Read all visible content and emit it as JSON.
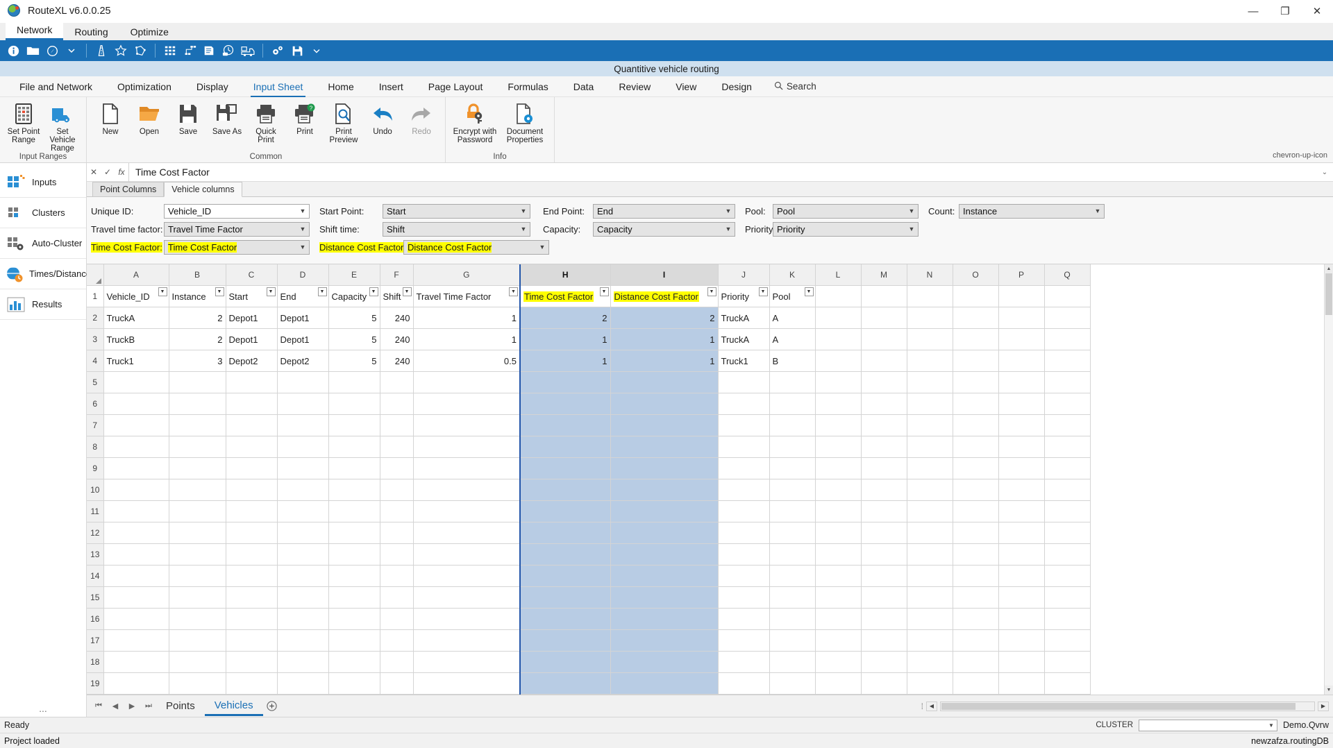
{
  "titlebar": {
    "app_title": "RouteXL v6.0.0.25",
    "minimize": "—",
    "maximize": "❐",
    "close": "✕"
  },
  "appmenu": {
    "items": [
      {
        "label": "Network",
        "active": true
      },
      {
        "label": "Routing",
        "active": false
      },
      {
        "label": "Optimize",
        "active": false
      }
    ]
  },
  "bluebar": {
    "icons": [
      "info-icon",
      "folder-icon",
      "compass-icon",
      "chevron-down-icon",
      "road-icon",
      "star-icon",
      "polygon-icon",
      "matrix-icon",
      "network-nodes-icon",
      "report-icon",
      "clock-icon",
      "truck-icon",
      "settings-gears-icon",
      "save-disk-icon",
      "chevron-down-small-icon"
    ]
  },
  "docbar": {
    "document_title": "Quantitive vehicle routing"
  },
  "ribbon_tabs": {
    "items": [
      {
        "label": "File and Network",
        "active": false
      },
      {
        "label": "Optimization",
        "active": false
      },
      {
        "label": "Display",
        "active": false
      },
      {
        "label": "Input Sheet",
        "active": true
      },
      {
        "label": "Home",
        "active": false
      },
      {
        "label": "Insert",
        "active": false
      },
      {
        "label": "Page Layout",
        "active": false
      },
      {
        "label": "Formulas",
        "active": false
      },
      {
        "label": "Data",
        "active": false
      },
      {
        "label": "Review",
        "active": false
      },
      {
        "label": "View",
        "active": false
      },
      {
        "label": "Design",
        "active": false
      }
    ],
    "search_label": "Search",
    "search_icon": "search-icon",
    "collapse_icon": "chevron-up-icon"
  },
  "ribbon": {
    "groups": [
      {
        "name": "Input Ranges",
        "buttons": [
          {
            "label": "Set Point Range",
            "icon": "grid-point-icon",
            "disabled": false
          },
          {
            "label": "Set Vehicle Range",
            "icon": "truck-icon",
            "disabled": false
          }
        ]
      },
      {
        "name": "Common",
        "buttons": [
          {
            "label": "New",
            "icon": "new-document-icon",
            "disabled": false
          },
          {
            "label": "Open",
            "icon": "open-folder-icon",
            "disabled": false
          },
          {
            "label": "Save",
            "icon": "save-disk-icon",
            "disabled": false
          },
          {
            "label": "Save As",
            "icon": "save-as-icon",
            "disabled": false
          },
          {
            "label": "Quick Print",
            "icon": "quick-print-icon",
            "disabled": false
          },
          {
            "label": "Print",
            "icon": "print-help-icon",
            "disabled": false
          },
          {
            "label": "Print Preview",
            "icon": "print-preview-icon",
            "disabled": false
          },
          {
            "label": "Undo",
            "icon": "undo-arrow-icon",
            "disabled": false
          },
          {
            "label": "Redo",
            "icon": "redo-arrow-icon",
            "disabled": true
          }
        ]
      },
      {
        "name": "Info",
        "buttons": [
          {
            "label": "Encrypt with Password",
            "icon": "lock-key-icon",
            "disabled": false
          },
          {
            "label": "Document Properties",
            "icon": "document-gear-icon",
            "disabled": false
          }
        ]
      }
    ]
  },
  "leftnav": {
    "items": [
      {
        "label": "Inputs",
        "icon": "grid-squares-icon"
      },
      {
        "label": "Clusters",
        "icon": "cluster-dots-icon"
      },
      {
        "label": "Auto-Cluster",
        "icon": "auto-cluster-icon"
      },
      {
        "label": "Times/Distances",
        "icon": "clock-globe-icon"
      },
      {
        "label": "Results",
        "icon": "bar-chart-icon"
      }
    ],
    "overflow": "..."
  },
  "formulabar": {
    "cancel": "✕",
    "accept": "✓",
    "fx": "fx",
    "value": "Time Cost Factor",
    "expand": "⌄"
  },
  "sheet_tabs": {
    "items": [
      {
        "label": "Point Columns",
        "active": false
      },
      {
        "label": "Vehicle columns",
        "active": true
      }
    ]
  },
  "form": {
    "rows": [
      [
        {
          "label": "Unique ID:",
          "value": "Vehicle_ID",
          "label_hl": false,
          "value_hl": false,
          "style": "white"
        },
        {
          "label": "Start Point:",
          "value": "Start",
          "label_hl": false,
          "value_hl": false,
          "style": "grey"
        },
        {
          "label": "End Point:",
          "value": "End",
          "label_hl": false,
          "value_hl": false,
          "style": "grey"
        },
        {
          "label": "Pool:",
          "value": "Pool",
          "label_hl": false,
          "value_hl": false,
          "style": "grey"
        },
        {
          "label": "Count:",
          "value": "Instance",
          "label_hl": false,
          "value_hl": false,
          "style": "grey"
        }
      ],
      [
        {
          "label": "Travel time factor:",
          "value": "Travel Time Factor",
          "label_hl": false,
          "value_hl": false,
          "style": "grey"
        },
        {
          "label": "Shift time:",
          "value": "Shift",
          "label_hl": false,
          "value_hl": false,
          "style": "grey"
        },
        {
          "label": "Capacity:",
          "value": "Capacity",
          "label_hl": false,
          "value_hl": false,
          "style": "grey"
        },
        {
          "label": "Priority",
          "value": "Priority",
          "label_hl": false,
          "value_hl": false,
          "style": "grey"
        }
      ],
      [
        {
          "label": "Time Cost Factor:",
          "value": "Time Cost Factor",
          "label_hl": true,
          "value_hl": true,
          "style": "grey"
        },
        {
          "label": "Distance Cost Factor:",
          "value": "Distance Cost Factor",
          "label_hl": true,
          "value_hl": true,
          "style": "grey"
        }
      ]
    ]
  },
  "spreadsheet": {
    "column_letters": [
      "A",
      "B",
      "C",
      "D",
      "E",
      "F",
      "G",
      "H",
      "I",
      "J",
      "K",
      "L",
      "M",
      "N",
      "O",
      "P",
      "Q"
    ],
    "selected_columns": [
      "H",
      "I"
    ],
    "headers": [
      {
        "text": "Vehicle_ID",
        "highlight": false
      },
      {
        "text": "Instance",
        "highlight": false
      },
      {
        "text": "Start",
        "highlight": false
      },
      {
        "text": "End",
        "highlight": false
      },
      {
        "text": "Capacity",
        "highlight": false
      },
      {
        "text": "Shift",
        "highlight": false
      },
      {
        "text": "Travel Time Factor",
        "highlight": false
      },
      {
        "text": "Time Cost Factor",
        "highlight": true
      },
      {
        "text": "Distance Cost Factor",
        "highlight": true
      },
      {
        "text": "Priority",
        "highlight": false
      },
      {
        "text": "Pool",
        "highlight": false
      },
      {
        "text": "",
        "highlight": false
      },
      {
        "text": "",
        "highlight": false
      },
      {
        "text": "",
        "highlight": false
      },
      {
        "text": "",
        "highlight": false
      },
      {
        "text": "",
        "highlight": false
      },
      {
        "text": "",
        "highlight": false
      }
    ],
    "rows": [
      {
        "num": "2",
        "cells": [
          "TruckA",
          "2",
          "Depot1",
          "Depot1",
          "5",
          "240",
          "1",
          "2",
          "2",
          "TruckA",
          "A",
          "",
          "",
          "",
          "",
          "",
          ""
        ]
      },
      {
        "num": "3",
        "cells": [
          "TruckB",
          "2",
          "Depot1",
          "Depot1",
          "5",
          "240",
          "1",
          "1",
          "1",
          "TruckA",
          "A",
          "",
          "",
          "",
          "",
          "",
          ""
        ]
      },
      {
        "num": "4",
        "cells": [
          "Truck1",
          "3",
          "Depot2",
          "Depot2",
          "5",
          "240",
          "0.5",
          "1",
          "1",
          "Truck1",
          "B",
          "",
          "",
          "",
          "",
          "",
          ""
        ]
      }
    ],
    "header_row_num": "1",
    "empty_row_nums": [
      "5",
      "6",
      "7",
      "8",
      "9",
      "10",
      "11",
      "12",
      "13",
      "14",
      "15",
      "16",
      "17",
      "18",
      "19"
    ],
    "numeric_columns": [
      1,
      4,
      5,
      6,
      7,
      8
    ],
    "filter_icon": "▼"
  },
  "sheetbar": {
    "nav": [
      "⏮",
      "◀",
      "▶",
      "⏭"
    ],
    "tabs": [
      {
        "label": "Points",
        "active": false
      },
      {
        "label": "Vehicles",
        "active": true
      }
    ],
    "add_icon": "+",
    "grip": "⁞",
    "scroll_left": "◀",
    "scroll_right": "▶"
  },
  "statusbar": {
    "ready": "Ready",
    "cluster_label": "CLUSTER",
    "cluster_value": "",
    "file_name": "Demo.Qvrw"
  },
  "statusbar2": {
    "message": "Project loaded",
    "db": "newzafza.routingDB"
  },
  "colors": {
    "accent_blue": "#1a6fb5",
    "highlight_yellow": "#ffff00",
    "selection_blue": "#b8cce4",
    "orange": "#f0922b"
  }
}
